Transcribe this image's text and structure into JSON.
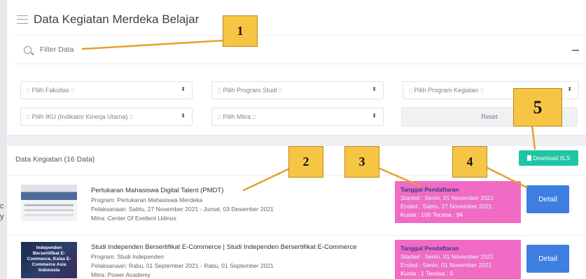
{
  "header": {
    "title": "Data Kegiatan Merdeka Belajar"
  },
  "filter": {
    "label": "Filter Data",
    "fakultas": ":: Pilih Fakultas ::",
    "program_studi": ":: Pilih Program Studi ::",
    "program_kegiatan": ":: Pilih Program Kegiatan ::",
    "iku": ":: Pilih IKU (Indikator Kinerja Utama) ::",
    "mitra": ":: Pilih Mitra ::",
    "reset_label": "Reset",
    "chevron": "⬍"
  },
  "list": {
    "header": "Data Kegiatan (16 Data)",
    "download_label": "Download XLS",
    "items": [
      {
        "name": "Pertukaran Mahasiswa Digital Talent (PMDT)",
        "program": "Program: Pertukaran Mahasiswa Merdeka",
        "pelaksanaan": "Pelaksanaan: Sabtu, 27 November 2021 - Jumat, 03 Desember 2021",
        "mitra": "Mitra: Center Of Exellent Udinus",
        "reg_title": "Tanggal Pendaftaran",
        "started": "Started : Senin, 01 November 2021",
        "ended": "Ended : Sabtu, 27 November 2021",
        "quota": "Kuota : 100 Tersisa : 94",
        "detail_label": "Detail"
      },
      {
        "name": "Studi Independen Bersertifikat E-Commerce | Studi Independen Bersertifikat E-Commerce",
        "program": "Program: Studi Independen",
        "pelaksanaan": "Pelaksanaan: Rabu, 01 September 2021 - Rabu, 01 September 2021",
        "mitra": "Mitra: Power Academy",
        "thumb_text": "Independen Bersertifikat E-Commerce, Kelas E-Commerce Asia Indonesia",
        "reg_title": "Tanggal Pendaftaran",
        "started": "Started : Senin, 01 November 2021",
        "ended": "Ended : Senin, 01 November 2021",
        "quota": "Kuota : 1 Tersisa : 0",
        "detail_label": "Detail"
      }
    ]
  },
  "cutoff_text": [
    "c",
    "y"
  ],
  "callouts": [
    "1",
    "2",
    "3",
    "4",
    "5"
  ],
  "colors": {
    "download": "#1fc6a3",
    "detail": "#3d7ee0",
    "registration_box": "#f16ac4",
    "callout": "#f6c544"
  }
}
